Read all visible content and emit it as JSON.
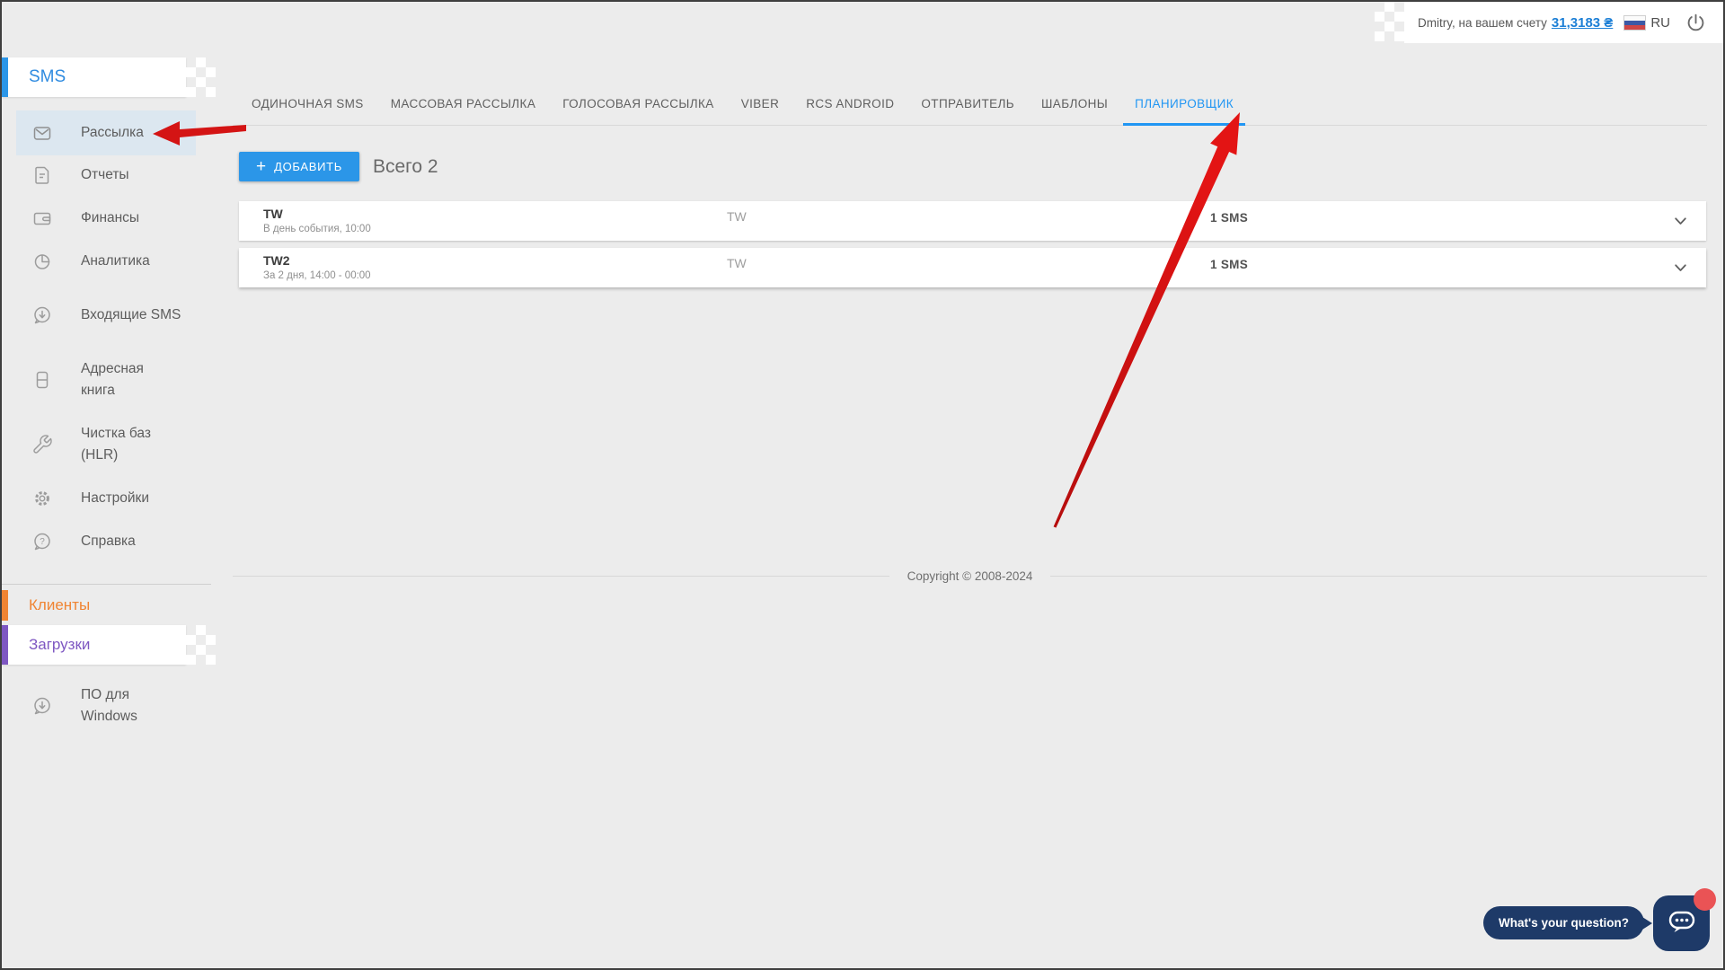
{
  "header": {
    "greeting": "Dmitry, на вашем счету",
    "balance": "31,3183 ₴",
    "language": "RU"
  },
  "sidebar": {
    "section_title": "SMS",
    "items": [
      {
        "label": "Рассылка"
      },
      {
        "label": "Отчеты"
      },
      {
        "label": "Финансы"
      },
      {
        "label": "Аналитика"
      },
      {
        "label": "Входящие SMS"
      },
      {
        "label": "Адресная книга"
      },
      {
        "label": "Чистка баз (HLR)"
      },
      {
        "label": "Настройки"
      },
      {
        "label": "Справка"
      }
    ],
    "clients_label": "Клиенты",
    "downloads_label": "Загрузки",
    "software_label": "ПО для Windows"
  },
  "tabs": [
    {
      "label": "ОДИНОЧНАЯ SMS"
    },
    {
      "label": "МАССОВАЯ РАССЫЛКА"
    },
    {
      "label": "ГОЛОСОВАЯ РАССЫЛКА"
    },
    {
      "label": "VIBER"
    },
    {
      "label": "RCS ANDROID"
    },
    {
      "label": "ОТПРАВИТЕЛЬ"
    },
    {
      "label": "ШАБЛОНЫ"
    },
    {
      "label": "ПЛАНИРОВЩИК",
      "active": true
    }
  ],
  "scheduler": {
    "add_button": "ДОБАВИТЬ",
    "total_label": "Всего 2",
    "rows": [
      {
        "title": "TW",
        "schedule": "В день события, 10:00",
        "sender": "TW",
        "volume": "1 SMS"
      },
      {
        "title": "TW2",
        "schedule": "За 2 дня, 14:00 - 00:00",
        "sender": "TW",
        "volume": "1 SMS"
      }
    ]
  },
  "footer": {
    "copyright": "Copyright © 2008-2024"
  },
  "chat": {
    "prompt": "What's your question?"
  },
  "icons": {
    "plus-icon": "+",
    "envelope-icon": "envelope",
    "report-icon": "document",
    "wallet-icon": "wallet",
    "pie-chart-icon": "pie-chart",
    "inbox-bubble-icon": "bubble-down-arrow",
    "address-book-icon": "book",
    "wrench-icon": "wrench",
    "gear-icon": "gear",
    "help-bubble-icon": "bubble-question",
    "download-bubble-icon": "bubble-down-arrow",
    "power-icon": "power",
    "chevron-down-icon": "chevron-down",
    "chat-bubble-icon": "speech-bubble-dots",
    "flag-ru-icon": "russian-flag"
  },
  "colors": {
    "accent_blue": "#2b96e8",
    "active_tab": "#2196f3",
    "sidebar_blue": "#2f8be0",
    "link_blue": "#1c7fd6",
    "highlight_blue": "#dce7f0",
    "orange": "#f08432",
    "purple": "#7e57c2",
    "navy": "#1e3a68",
    "arrow_red": "#d41414",
    "notification_red": "#ea5355"
  }
}
